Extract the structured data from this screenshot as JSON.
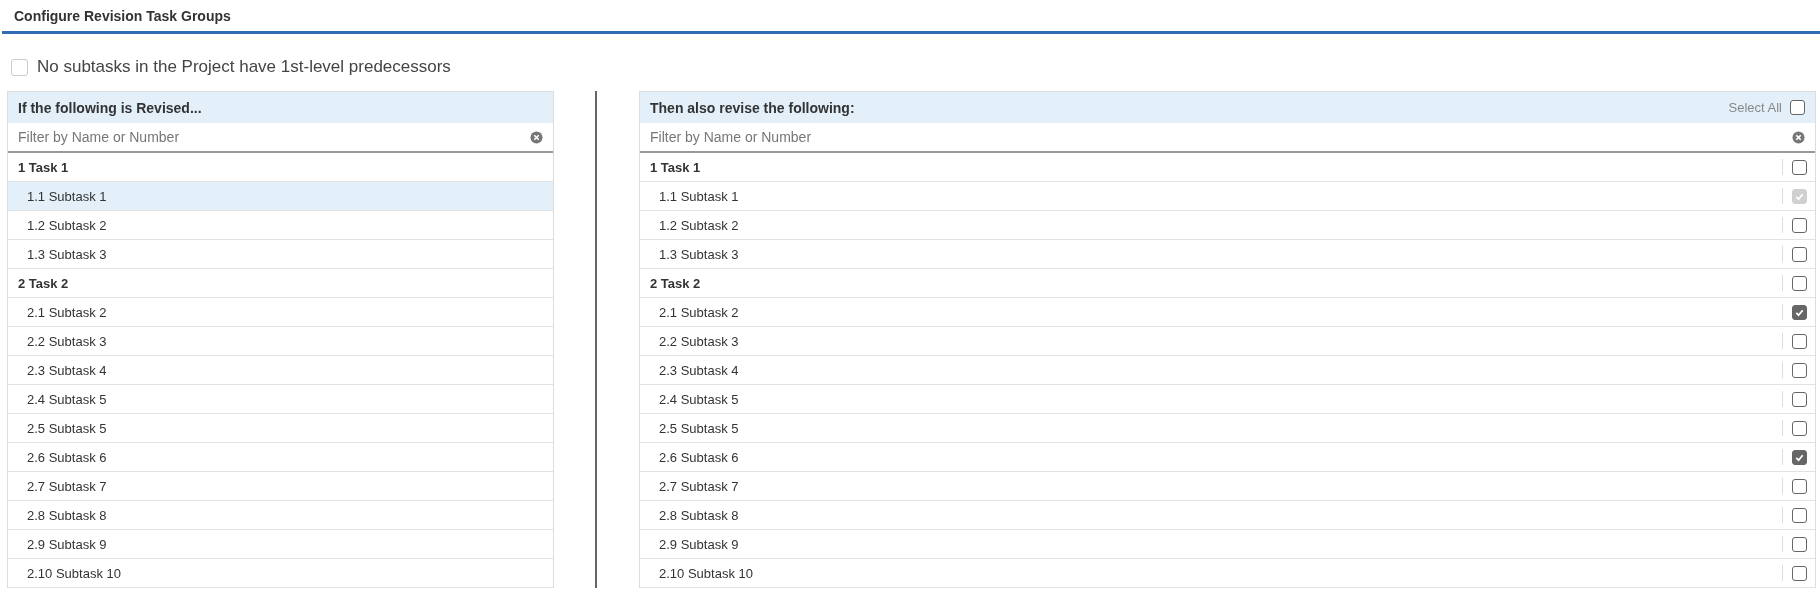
{
  "window": {
    "title": "Configure Revision Task Groups"
  },
  "option": {
    "label": "No subtasks in the Project have 1st-level predecessors",
    "checked": false,
    "disabled": true
  },
  "left_panel": {
    "heading": "If the following is Revised...",
    "filter": {
      "placeholder": "Filter by Name or Number"
    },
    "tasks": [
      {
        "label": "1 Task 1",
        "selected": false,
        "children": [
          {
            "label": "1.1 Subtask 1",
            "selected": true
          },
          {
            "label": "1.2 Subtask 2",
            "selected": false
          },
          {
            "label": "1.3 Subtask 3",
            "selected": false
          }
        ]
      },
      {
        "label": "2 Task 2",
        "selected": false,
        "children": [
          {
            "label": "2.1 Subtask 2",
            "selected": false
          },
          {
            "label": "2.2 Subtask 3",
            "selected": false
          },
          {
            "label": "2.3 Subtask 4",
            "selected": false
          },
          {
            "label": "2.4 Subtask 5",
            "selected": false
          },
          {
            "label": "2.5 Subtask 5",
            "selected": false
          },
          {
            "label": "2.6 Subtask 6",
            "selected": false
          },
          {
            "label": "2.7 Subtask 7",
            "selected": false
          },
          {
            "label": "2.8 Subtask 8",
            "selected": false
          },
          {
            "label": "2.9 Subtask 9",
            "selected": false
          },
          {
            "label": "2.10 Subtask 10",
            "selected": false
          }
        ]
      }
    ]
  },
  "right_panel": {
    "heading": "Then also revise the following:",
    "select_all": {
      "label": "Select All",
      "checked": false
    },
    "filter": {
      "placeholder": "Filter by Name or Number"
    },
    "tasks": [
      {
        "label": "1 Task 1",
        "checked": false,
        "disabled": false,
        "children": [
          {
            "label": "1.1 Subtask 1",
            "checked": true,
            "disabled": true
          },
          {
            "label": "1.2 Subtask 2",
            "checked": false,
            "disabled": false
          },
          {
            "label": "1.3 Subtask 3",
            "checked": false,
            "disabled": false
          }
        ]
      },
      {
        "label": "2 Task 2",
        "checked": false,
        "disabled": false,
        "children": [
          {
            "label": "2.1 Subtask 2",
            "checked": true,
            "disabled": false
          },
          {
            "label": "2.2 Subtask 3",
            "checked": false,
            "disabled": false
          },
          {
            "label": "2.3 Subtask 4",
            "checked": false,
            "disabled": false
          },
          {
            "label": "2.4 Subtask 5",
            "checked": false,
            "disabled": false
          },
          {
            "label": "2.5 Subtask 5",
            "checked": false,
            "disabled": false
          },
          {
            "label": "2.6 Subtask 6",
            "checked": true,
            "disabled": false
          },
          {
            "label": "2.7 Subtask 7",
            "checked": false,
            "disabled": false
          },
          {
            "label": "2.8 Subtask 8",
            "checked": false,
            "disabled": false
          },
          {
            "label": "2.9 Subtask 9",
            "checked": false,
            "disabled": false
          },
          {
            "label": "2.10 Subtask 10",
            "checked": false,
            "disabled": false
          }
        ]
      }
    ]
  }
}
